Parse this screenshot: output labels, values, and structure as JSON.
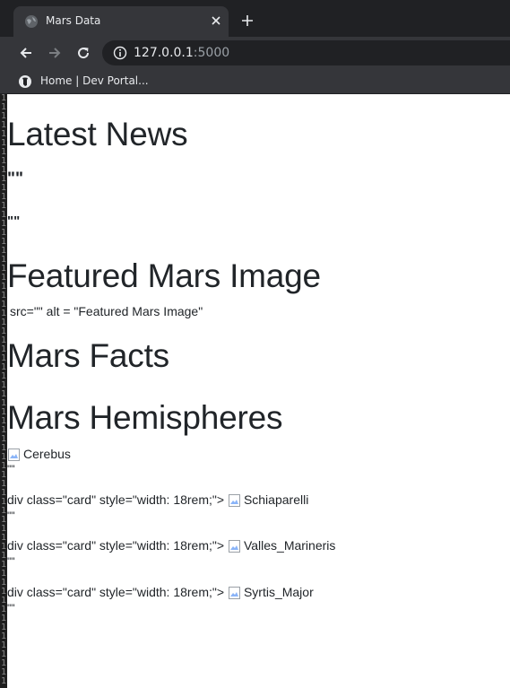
{
  "browser": {
    "tab_title": "Mars Data",
    "url_host": "127.0.0.1",
    "url_port": ":5000",
    "bookmark_label": "Home | Dev Portal...",
    "icons": {
      "favicon": "globe-icon",
      "close": "close-icon",
      "new_tab": "plus-icon",
      "back": "back-arrow-icon",
      "forward": "forward-arrow-icon",
      "reload": "reload-icon",
      "site_info": "info-icon",
      "bookmark": "nyt-logo-icon"
    }
  },
  "gutter_digits": [
    "1",
    "1",
    "1",
    "1",
    "1",
    "1",
    "1",
    "1",
    "1",
    "1",
    "1",
    "1",
    "1",
    "1",
    "1",
    "1",
    "1",
    "1",
    "1",
    "1",
    "1",
    "1",
    "1",
    "1",
    "1",
    "1",
    "1",
    "1",
    "1",
    "1",
    "1",
    "1",
    "1",
    "1",
    "1",
    "1",
    "1",
    "1",
    "1",
    "1",
    "1",
    "1",
    "1",
    "1",
    "1",
    "1",
    "1",
    "1",
    "1",
    "1",
    "1",
    "1",
    "1",
    "1",
    "1",
    "1",
    "1",
    "1",
    "1",
    "1",
    "1",
    "1",
    "1",
    "1",
    "1",
    "1"
  ],
  "page": {
    "news_heading": "Latest News",
    "news_title_placeholder": "\"\"",
    "news_paragraph_placeholder": "\"\"",
    "featured_heading": "Featured Mars Image",
    "featured_text": "src=\"\" alt = \"Featured Mars Image\"",
    "facts_heading": "Mars Facts",
    "hemispheres_heading": "Mars Hemispheres",
    "hemispheres": [
      {
        "prefix": "",
        "alt": "Cerebus",
        "caption": "\"\""
      },
      {
        "prefix": "div class=\"card\" style=\"width: 18rem;\">",
        "alt": "Schiaparelli",
        "caption": "\"\""
      },
      {
        "prefix": "div class=\"card\" style=\"width: 18rem;\">",
        "alt": "Valles_Marineris",
        "caption": "\"\""
      },
      {
        "prefix": "div class=\"card\" style=\"width: 18rem;\">",
        "alt": "Syrtis_Major",
        "caption": "\"\""
      }
    ]
  }
}
